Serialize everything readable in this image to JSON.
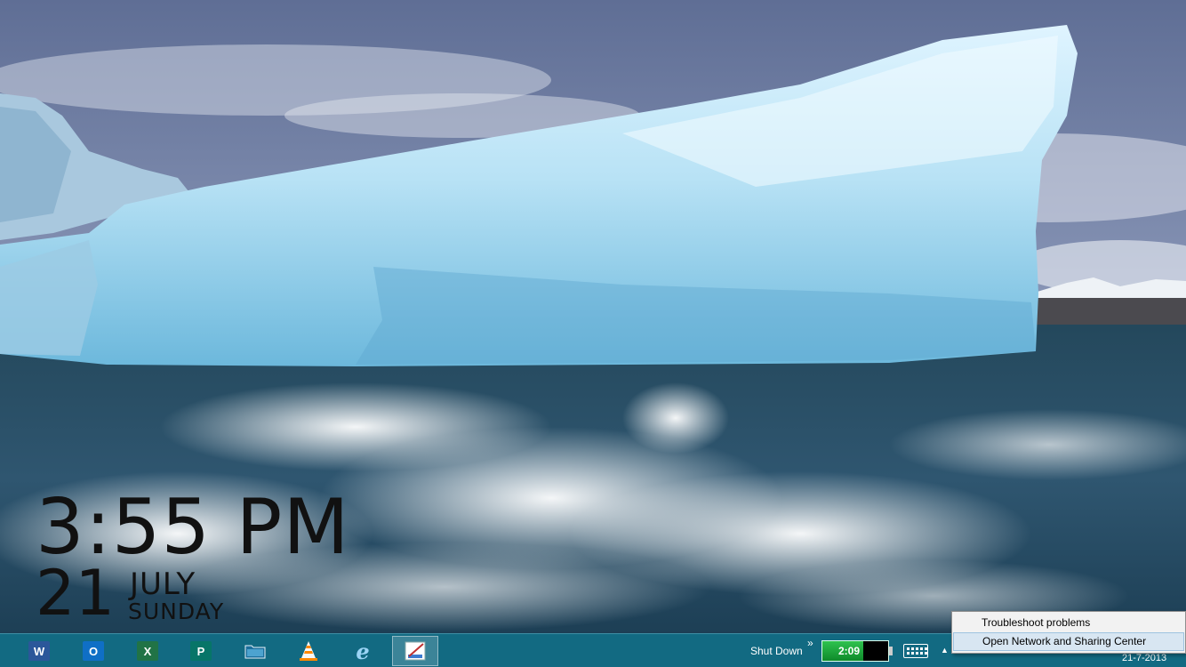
{
  "clock": {
    "time": "3:55 PM",
    "day": "21",
    "month": "JULY",
    "weekday": "SUNDAY"
  },
  "taskbar": {
    "apps": [
      {
        "name": "word",
        "icon": "word-icon",
        "glyph": "W",
        "color": "#2b579a",
        "active": false
      },
      {
        "name": "outlook",
        "icon": "outlook-icon",
        "glyph": "O",
        "color": "#0f6fc6",
        "active": false
      },
      {
        "name": "excel",
        "icon": "excel-icon",
        "glyph": "X",
        "color": "#217346",
        "active": false
      },
      {
        "name": "publisher",
        "icon": "publisher-icon",
        "glyph": "P",
        "color": "#077568",
        "active": false
      },
      {
        "name": "file-explorer",
        "icon": "folder-icon",
        "glyph": "",
        "color": "#e8b43c",
        "active": false
      },
      {
        "name": "vlc",
        "icon": "vlc-cone-icon",
        "glyph": "",
        "color": "#ff8800",
        "active": false
      },
      {
        "name": "internet-explorer",
        "icon": "internet-explorer-icon",
        "glyph": "e",
        "color": "#1ea1e5",
        "active": false
      },
      {
        "name": "paint",
        "icon": "paint-icon",
        "glyph": "",
        "color": "#ffffff",
        "active": true
      }
    ],
    "shutdown_label": "Shut Down",
    "more_chevron": "»",
    "battery": {
      "label": "2:09",
      "level": 0.62
    },
    "tray_chevron": "▲",
    "date": "21-7-2013"
  },
  "context_menu": {
    "items": [
      {
        "label": "Troubleshoot problems",
        "highlighted": false
      },
      {
        "label": "Open Network and Sharing Center",
        "highlighted": true
      }
    ]
  },
  "colors": {
    "taskbar": "#126a82",
    "menu_bg": "#f2f2f2",
    "menu_highlight": "#d8e6f2",
    "battery_green": "#1fa83d"
  }
}
